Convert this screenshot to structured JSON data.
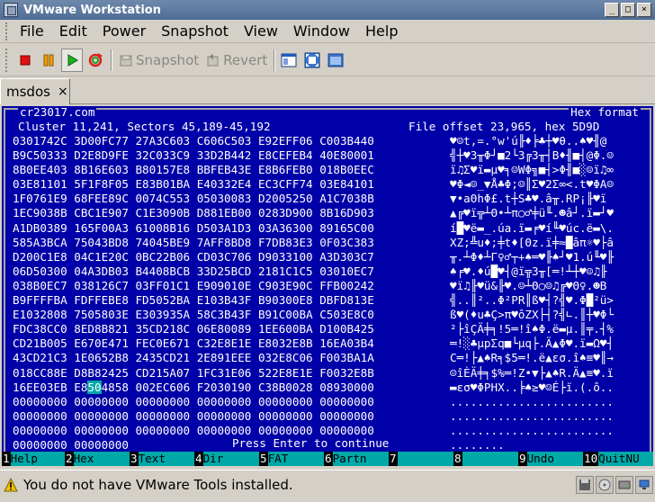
{
  "window": {
    "title": "VMware Workstation"
  },
  "menu": [
    "File",
    "Edit",
    "Power",
    "Snapshot",
    "View",
    "Window",
    "Help"
  ],
  "toolbar": {
    "snapshot_label": "Snapshot",
    "revert_label": "Revert"
  },
  "tab": {
    "label": "msdos",
    "close": "×"
  },
  "console": {
    "host": "cr23017.com",
    "mode": "Hex format",
    "cluster_line": "Cluster 11,241, Sectors 45,189-45,192",
    "offset_line": "File offset 23,965, hex 5D9D",
    "hex_rows": [
      "0301742C 3D00FC77 27A3C603 C606C503 E92EFF06 C003B440",
      "B9C50333 D2E8D9FE 32C033C9 33D2B442 E8CEFEB4 40E80001",
      "8B0EE403 8B16E603 B80157E8 BBFEB43E E8B6FEB0 018B0EEC",
      "03E81101 5F1F8F05 E83B01BA E40332E4 EC3CFF74 03E84101",
      "1F0761E9 68FEE89C 0074C553 05030083 D2005250 A1C7038B",
      "1EC9038B CBC1E907 C1E3090B D881EB00 0283D900 8B16D903",
      "A1DB0389 165F00A3 61008B16 D503A1D3 03A36300 89165C00",
      "585A3BCA 75043BD8 74045BE9 7AFF8BD8 F7DB83E3 0F03C383",
      "D200C1E8 04C1E20C 0BC22B06 CD03C706 D9033100 A3D303C7",
      "06D50300 04A3DB03 B4408BCB 33D25BCD 2181C1C5 03010EC7",
      "038B0EC7 038126C7 03FF01C1 E909010E C903E90C FFB00242",
      "B9FFFFBA FDFFEBE8 FD5052BA E103B43F B90300E8 DBFD813E",
      "E1032808 7505803E E303935A 58C3B43F B91C00BA C503E8C0",
      "FDC38CC0 8ED8B821 35CD218C 06E80089 1EE600BA D100B425",
      "CD21B005 E670E471 FEC0E671 C32E8E1E E8032E8B 16EA03B4",
      "43CD21C3 1E0652B8 2435CD21 2E891EEE 032E8C06 F003BA1A",
      "018CC88E D8B82425 CD215A07 1FC31E06 522E8E1E F0032E8B",
      "16EE03EB E8504858 002EC606 F2030190 C38B0028 08930000",
      "00000000 00000000 00000000 00000000 00000000 00000000",
      "00000000 00000000 00000000 00000000 00000000 00000000",
      "00000000 00000000 00000000 00000000 00000000 00000000",
      "00000000 00000000"
    ],
    "ascii_rows": [
      "♥☺t,=.°w'ú╟♦╞♣┼♥θ..♠♥╢@",
      "╣┼♥3╥Φ┘■2└3╔3╥┤B♦╢■┤@Φ.☺",
      "ï♫Σ♥ï▬µ♥╕☺WΦ╗■┤>Φ╢■░☺ï♫∞",
      "♥Φ◄☺_▼Å♣Φ;☺║Σ♥2Σ∞<.t♥ΦA☺",
      "▼•aΘhΦ£.t┼S♣♥.â╥.RP¡╟♥ï",
      "▲╔♥ï╦┴Θ•┴π○♂╪ü╙.☻â┘.ï▬┘♥",
      "í█♥ë▬_.úa.ï▬╒♥í╙♥úc.ë▬\\.",
      "XZ;╩u♦;╪t♦[Θz.ï╪≈█âπ☼♥├â",
      "╥.┴Φ♦┴Γ♀♂┬+♠═♥╟♠┘♥1.ú╙♥╟",
      "♠╒♥.♦ú█♥┤@ï╦3╥[═!┴┼♥☺♫╟",
      "♥ï♫╟♥ü&╟♥.☺┴Θ○☺♫╔♥Θ♀.☻B",
      "╣..║²..Φ²PR║ß♥┤?╣♥.Φ█²ü>",
      "ß♥(♦u♣Ç>π♥ôZX├┤?╣∟.║┼♥Φ└",
      "²├îÇÄ╪╕!5═!î♠Φ.ë▬µ.║╤.┤%",
      "═!░♣µpΣq■└µq├.Ä▲Φ♥.ï▬Ω♥┤",
      "C═!├▲♠R╕$5═!.ë▲εσ.î♠≡♥║→",
      "☺îÈÄ╪╕$%═!Z•▼├▲♠R.Ä▲≡♥.ï",
      "▬εσ♥ΦPHX..╞♠≥♥☺É├ï.(.ô..",
      "........................",
      "........................",
      "........................",
      "........"
    ],
    "highlight": "50",
    "prompt": "Press Enter to continue",
    "fkeys": [
      {
        "num": "1",
        "label": "Help"
      },
      {
        "num": "2",
        "label": "Hex"
      },
      {
        "num": "3",
        "label": "Text"
      },
      {
        "num": "4",
        "label": "Dir"
      },
      {
        "num": "5",
        "label": "FAT"
      },
      {
        "num": "6",
        "label": "Partn"
      },
      {
        "num": "7",
        "label": ""
      },
      {
        "num": "8",
        "label": ""
      },
      {
        "num": "9",
        "label": "Undo"
      },
      {
        "num": "10",
        "label": "QuitNU"
      }
    ]
  },
  "status": {
    "message": "You do not have VMware Tools installed."
  },
  "colors": {
    "console_bg": "#0000a8",
    "console_fg": "#a8a8a8",
    "fkey_bg": "#00a8a8",
    "titlebar": "#5a779f"
  }
}
